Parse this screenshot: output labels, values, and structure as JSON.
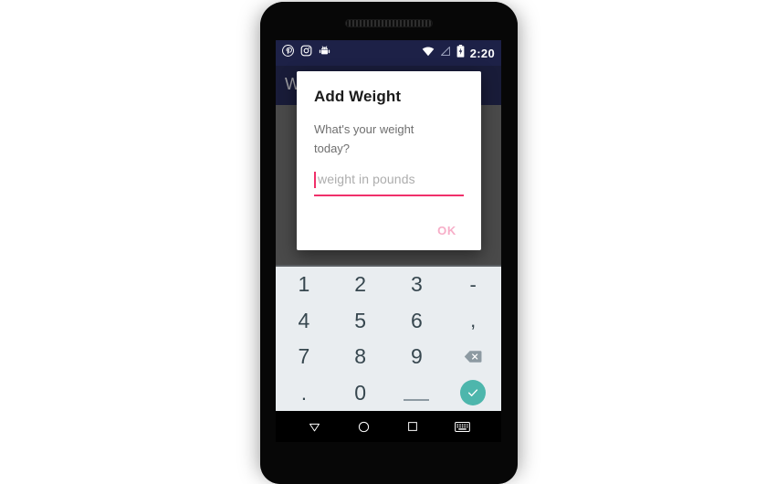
{
  "device": {
    "speaker_icon": "speaker-grille"
  },
  "status_bar": {
    "left_icons": [
      {
        "name": "pinterest-icon",
        "label": "Pinterest"
      },
      {
        "name": "instagram-icon",
        "label": "Instagram"
      },
      {
        "name": "android-robot-icon",
        "label": "Android"
      }
    ],
    "right_icons": [
      {
        "name": "wifi-icon",
        "label": "Wi-Fi"
      },
      {
        "name": "cellular-signal-off-icon",
        "label": "No signal"
      },
      {
        "name": "battery-charging-icon",
        "label": "Battery charging"
      }
    ],
    "clock": "2:20"
  },
  "app_bar": {
    "title": "W"
  },
  "dialog": {
    "title": "Add Weight",
    "message": "What's your weight today?",
    "input": {
      "value": "",
      "placeholder": "weight in pounds",
      "accent_color": "#f0306a"
    },
    "ok_label": "OK",
    "ok_color": "#f7aec8"
  },
  "keyboard": {
    "keys": [
      {
        "label": "1",
        "name": "key-1",
        "type": "digit"
      },
      {
        "label": "2",
        "name": "key-2",
        "type": "digit"
      },
      {
        "label": "3",
        "name": "key-3",
        "type": "digit"
      },
      {
        "label": "-",
        "name": "key-minus",
        "type": "symbol"
      },
      {
        "label": "4",
        "name": "key-4",
        "type": "digit"
      },
      {
        "label": "5",
        "name": "key-5",
        "type": "digit"
      },
      {
        "label": "6",
        "name": "key-6",
        "type": "digit"
      },
      {
        "label": ",",
        "name": "key-comma",
        "type": "symbol"
      },
      {
        "label": "7",
        "name": "key-7",
        "type": "digit"
      },
      {
        "label": "8",
        "name": "key-8",
        "type": "digit"
      },
      {
        "label": "9",
        "name": "key-9",
        "type": "digit"
      },
      {
        "label": "",
        "name": "key-backspace",
        "type": "backspace"
      },
      {
        "label": ".",
        "name": "key-period",
        "type": "symbol"
      },
      {
        "label": "0",
        "name": "key-0",
        "type": "digit"
      },
      {
        "label": "",
        "name": "key-space",
        "type": "space"
      },
      {
        "label": "",
        "name": "key-enter",
        "type": "enter"
      }
    ],
    "enter_color": "#4db6ac",
    "background_color": "#e9edf0"
  },
  "nav_bar": {
    "buttons": [
      {
        "name": "nav-back-button",
        "icon": "triangle-back-icon"
      },
      {
        "name": "nav-home-button",
        "icon": "circle-home-icon"
      },
      {
        "name": "nav-recents-button",
        "icon": "square-recents-icon"
      },
      {
        "name": "nav-keyboard-button",
        "icon": "keyboard-icon"
      }
    ]
  }
}
